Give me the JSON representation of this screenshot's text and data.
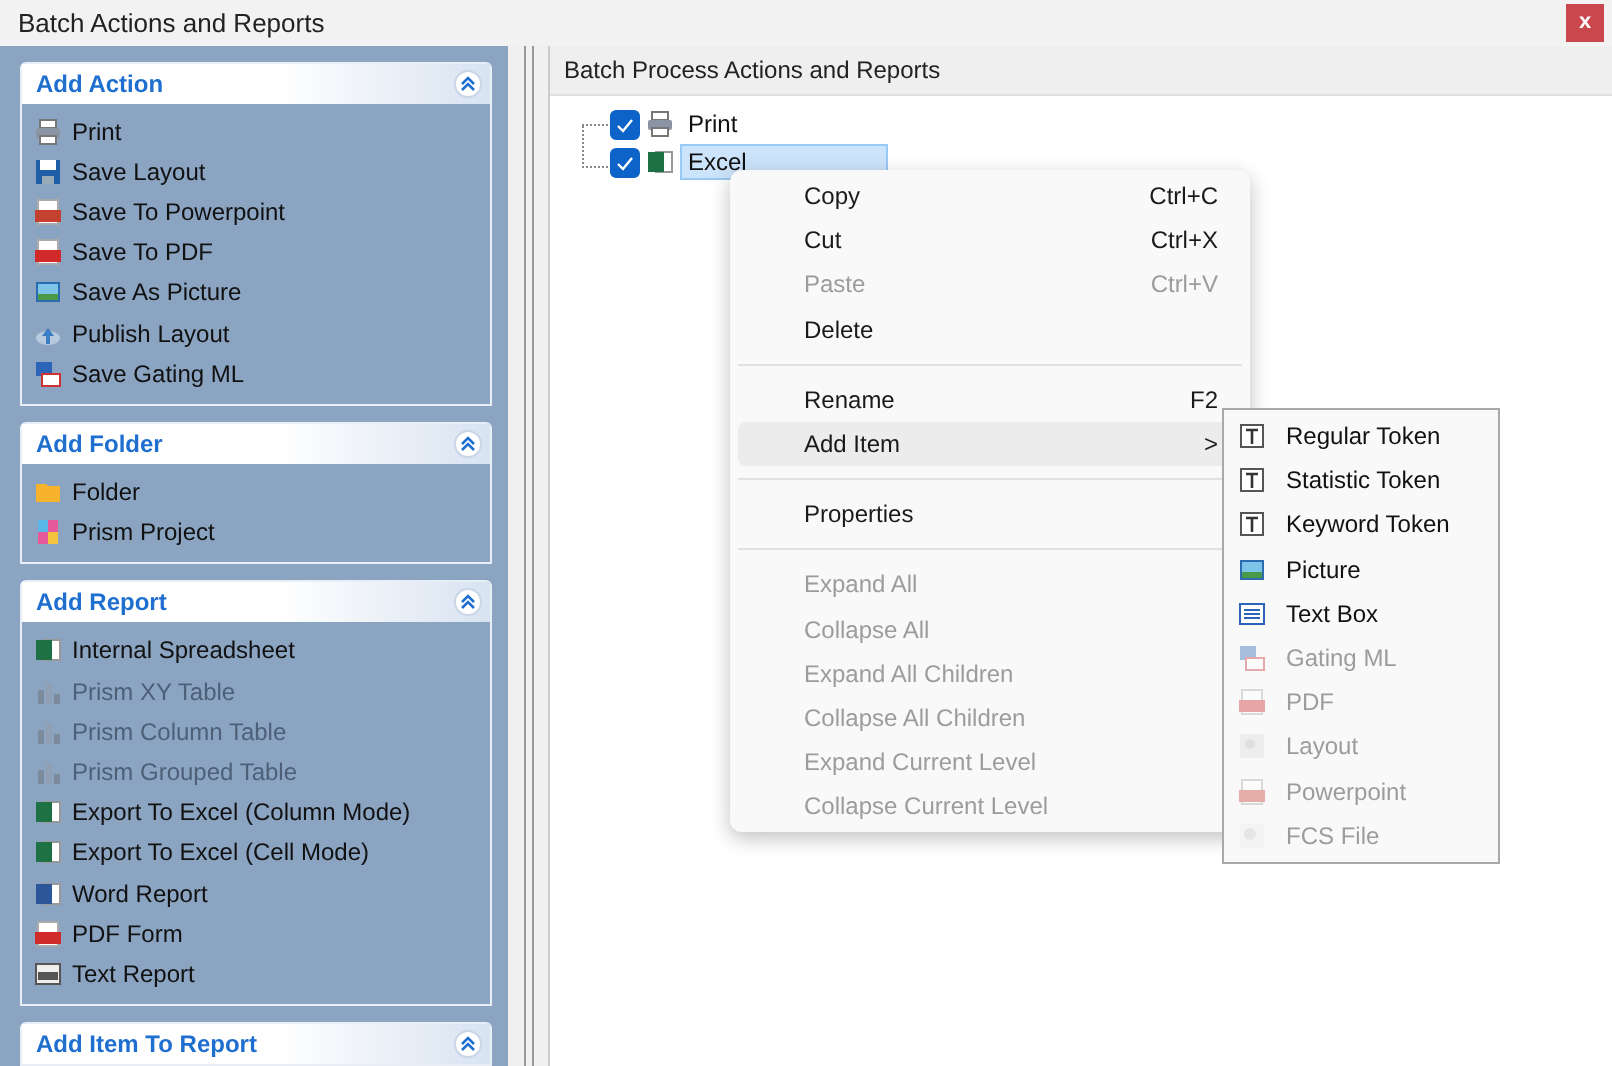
{
  "window": {
    "title": "Batch Actions and Reports",
    "close": "x"
  },
  "sidebar": {
    "sections": [
      {
        "title": "Add Action",
        "items": [
          {
            "label": "Print",
            "disabled": false
          },
          {
            "label": "Save Layout",
            "disabled": false
          },
          {
            "label": "Save To Powerpoint",
            "disabled": false
          },
          {
            "label": "Save To PDF",
            "disabled": false
          },
          {
            "label": "Save As Picture",
            "disabled": false
          },
          {
            "label": "Publish Layout",
            "disabled": false
          },
          {
            "label": "Save Gating ML",
            "disabled": false
          }
        ]
      },
      {
        "title": "Add Folder",
        "items": [
          {
            "label": "Folder",
            "disabled": false
          },
          {
            "label": "Prism Project",
            "disabled": false
          }
        ]
      },
      {
        "title": "Add Report",
        "items": [
          {
            "label": "Internal Spreadsheet",
            "disabled": false
          },
          {
            "label": "Prism XY Table",
            "disabled": true
          },
          {
            "label": "Prism Column Table",
            "disabled": true
          },
          {
            "label": "Prism Grouped Table",
            "disabled": true
          },
          {
            "label": "Export To Excel (Column Mode)",
            "disabled": false
          },
          {
            "label": "Export To Excel (Cell Mode)",
            "disabled": false
          },
          {
            "label": "Word Report",
            "disabled": false
          },
          {
            "label": "PDF Form",
            "disabled": false
          },
          {
            "label": "Text Report",
            "disabled": false
          }
        ]
      },
      {
        "title": "Add Item To Report"
      }
    ]
  },
  "panel": {
    "title": "Batch Process Actions and Reports"
  },
  "tree": [
    {
      "label": "Print",
      "checked": true,
      "selected": false
    },
    {
      "label": "Excel",
      "checked": true,
      "selected": true
    }
  ],
  "context_menu": [
    {
      "kind": "item",
      "label": "Copy",
      "shortcut": "Ctrl+C",
      "disabled": false,
      "selected": false
    },
    {
      "kind": "item",
      "label": "Cut",
      "shortcut": "Ctrl+X",
      "disabled": false,
      "selected": false
    },
    {
      "kind": "item",
      "label": "Paste",
      "shortcut": "Ctrl+V",
      "disabled": true,
      "selected": false
    },
    {
      "kind": "item",
      "label": "Delete",
      "disabled": false,
      "selected": false
    },
    {
      "kind": "separator"
    },
    {
      "kind": "item",
      "label": "Rename",
      "shortcut": "F2",
      "disabled": false,
      "selected": false
    },
    {
      "kind": "submenu",
      "label": "Add Item",
      "arrow": ">",
      "disabled": false,
      "selected": true
    },
    {
      "kind": "separator"
    },
    {
      "kind": "item",
      "label": "Properties",
      "disabled": false,
      "selected": false
    },
    {
      "kind": "separator"
    },
    {
      "kind": "item",
      "label": "Expand All",
      "disabled": true,
      "selected": false
    },
    {
      "kind": "item",
      "label": "Collapse All",
      "disabled": true,
      "selected": false
    },
    {
      "kind": "item",
      "label": "Expand All Children",
      "disabled": true,
      "selected": false
    },
    {
      "kind": "item",
      "label": "Collapse All Children",
      "disabled": true,
      "selected": false
    },
    {
      "kind": "item",
      "label": "Expand Current Level",
      "disabled": true,
      "selected": false
    },
    {
      "kind": "item",
      "label": "Collapse Current Level",
      "disabled": true,
      "selected": false
    }
  ],
  "submenu": [
    {
      "label": "Regular Token",
      "disabled": false
    },
    {
      "label": "Statistic Token",
      "disabled": false
    },
    {
      "label": "Keyword Token",
      "disabled": false
    },
    {
      "label": "Picture",
      "disabled": false
    },
    {
      "label": "Text Box",
      "disabled": false
    },
    {
      "label": "Gating ML",
      "disabled": true
    },
    {
      "label": "PDF",
      "disabled": true
    },
    {
      "label": "Layout",
      "disabled": true
    },
    {
      "label": "Powerpoint",
      "disabled": true
    },
    {
      "label": "FCS File",
      "disabled": true
    }
  ]
}
